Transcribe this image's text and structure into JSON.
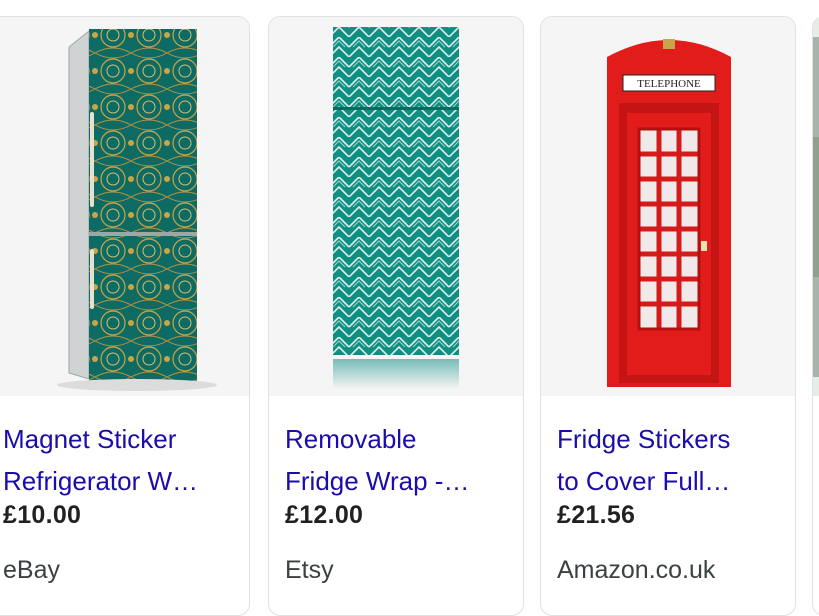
{
  "results": [
    {
      "title_line1": "Magnet Sticker",
      "title_line2": "Refrigerator W…",
      "price": "£10.00",
      "store": "eBay",
      "image": "teal-gold-paisley-fridge"
    },
    {
      "title_line1": "Removable",
      "title_line2": "Fridge Wrap -…",
      "price": "£12.00",
      "store": "Etsy",
      "image": "teal-chevron-fridge"
    },
    {
      "title_line1": "Fridge Stickers",
      "title_line2": "to Cover Full…",
      "price": "£21.56",
      "store": "Amazon.co.uk",
      "image": "red-telephone-box-fridge",
      "sign": "TELEPHONE"
    }
  ],
  "colors": {
    "link": "#1a0dab",
    "teal": "#0f8f82",
    "red": "#e21b1b",
    "gold": "#c9a54a"
  }
}
